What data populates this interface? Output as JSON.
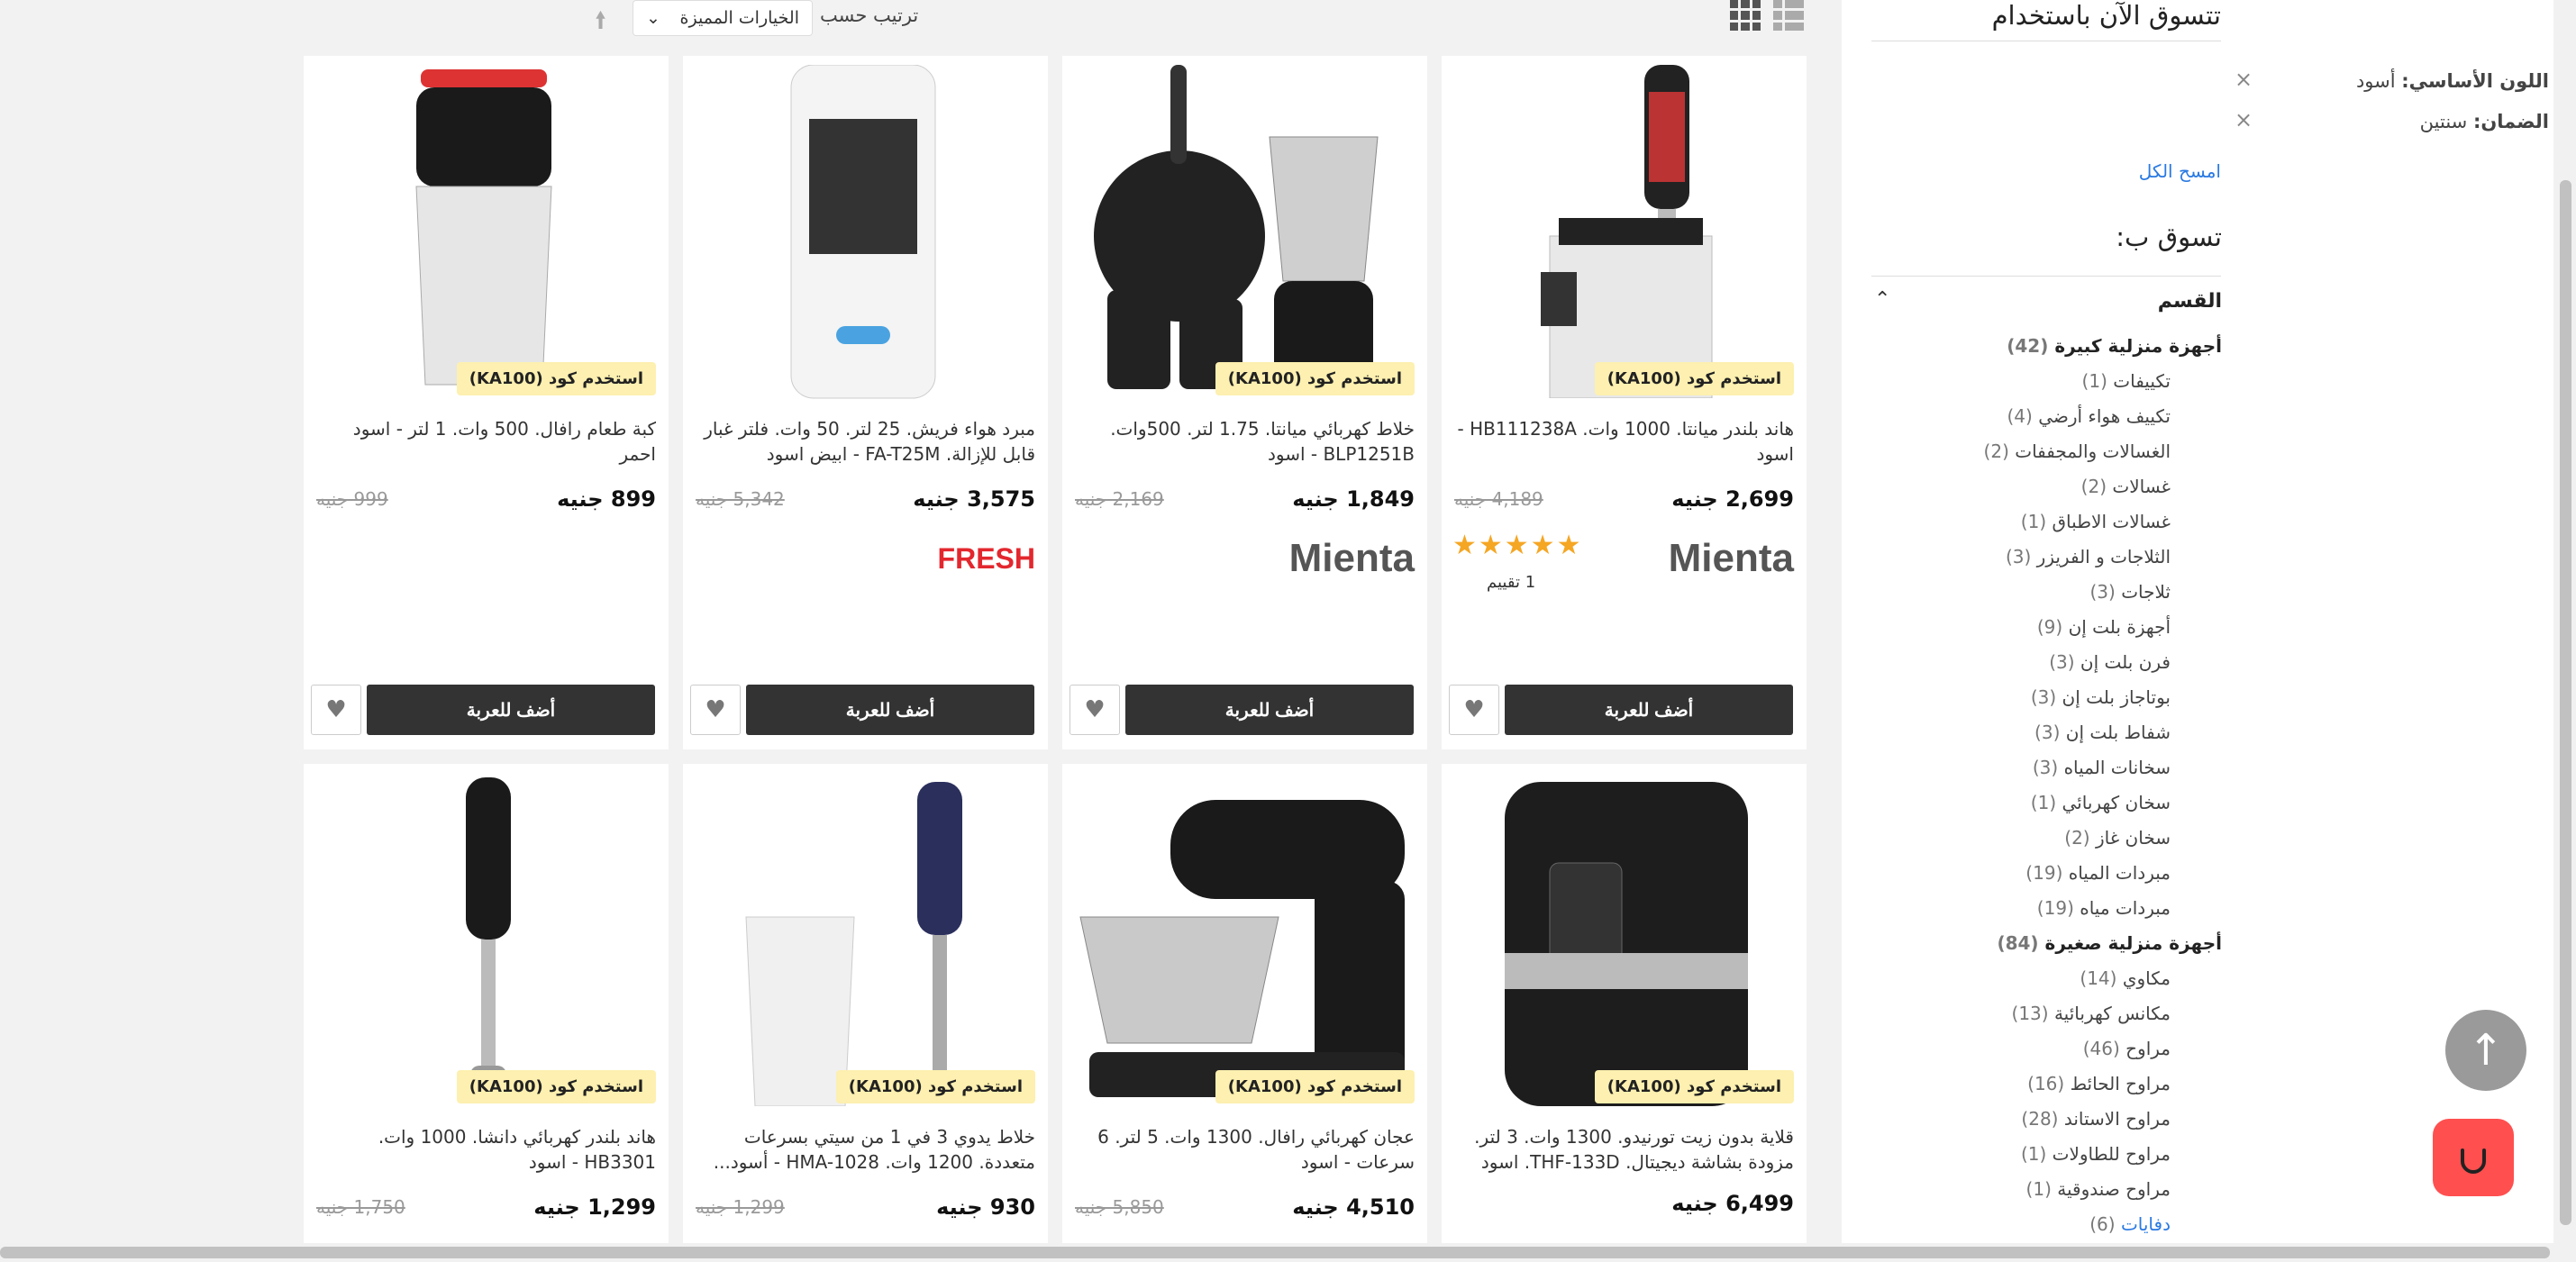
{
  "toolbar": {
    "sort_label": "ترتيب حسب",
    "sort_value": "الخيارات المميزة",
    "sort_dir_icon": "arrow-up-icon",
    "view_grid_icon": "grid-view-icon",
    "view_list_icon": "list-view-icon"
  },
  "products": [
    {
      "promo": "استخدم كود (KA100)",
      "title": "هاند بلندر ميانتا. 1000 وات. HB111238A - اسود",
      "price": "2,699 جنيه",
      "old_price": "4,189 جنيه",
      "brand": "Mienta",
      "stars": "★★★★★",
      "reviews": "1 تقييم",
      "add": "أضف للعربة"
    },
    {
      "promo": "استخدم كود (KA100)",
      "title": "خلاط كهربائي ميانتا. 1.75 لتر. 500وات. BLP1251B - اسود",
      "price": "1,849 جنيه",
      "old_price": "2,169 جنيه",
      "brand": "Mienta",
      "add": "أضف للعربة"
    },
    {
      "title": "مبرد هواء فريش. 25 لتر. 50 وات. فلتر غبار قابل للإزالة. FA-T25M - ابيض اسود",
      "price": "3,575 جنيه",
      "old_price": "5,342 جنيه",
      "brand": "FRESH",
      "add": "أضف للعربة"
    },
    {
      "promo": "استخدم كود (KA100)",
      "title": "كبة طعام رافال. 500 وات. 1 لتر - اسود احمر",
      "price": "899 جنيه",
      "old_price": "999 جنيه",
      "add": "أضف للعربة"
    },
    {
      "promo": "استخدم كود (KA100)",
      "title": "قلاية بدون زيت تورنيدو. 1300 وات. 3 لتر. مزودة بشاشة ديجيتال. THF-133D. اسود",
      "price": "6,499 جنيه"
    },
    {
      "promo": "استخدم كود (KA100)",
      "title": "عجان كهربائي رافال. 1300 وات. 5 لتر. 6 سرعات - اسود",
      "price": "4,510 جنيه",
      "old_price": "5,850 جنيه"
    },
    {
      "promo": "استخدم كود (KA100)",
      "title": "خلاط يدوي 3 في 1 من سيتي بسرعات متعددة. 1200 وات. HMA-1028 - أسود...",
      "price": "930 جنيه",
      "old_price": "1,299 جنيه"
    },
    {
      "promo": "استخدم كود (KA100)",
      "title": "هاند بلندر كهربائي دانشا. 1000 وات. HB3301 - اسود",
      "price": "1,299 جنيه",
      "old_price": "1,750 جنيه"
    }
  ],
  "sidebar": {
    "title": "تتسوق الآن باستخدام",
    "filters": [
      {
        "name": "اللون الأساسي:",
        "value": "أسود"
      },
      {
        "name": "الضمان:",
        "value": "سنتين"
      }
    ],
    "clear_all": "امسح الكل",
    "shop_by": "تسوق ب:",
    "category_header": "القسم",
    "categories": [
      {
        "label": "أجهزة منزلية كبيرة",
        "count": "(42)",
        "main": true
      },
      {
        "label": "تكييفات",
        "count": "(1)"
      },
      {
        "label": "تكييف هواء أرضي",
        "count": "(4)"
      },
      {
        "label": "الغسالات والمجففات",
        "count": "(2)"
      },
      {
        "label": "غسالات",
        "count": "(2)"
      },
      {
        "label": "غسالات الاطباق",
        "count": "(1)"
      },
      {
        "label": "الثلاجات و الفريزر",
        "count": "(3)"
      },
      {
        "label": "ثلاجات",
        "count": "(3)"
      },
      {
        "label": "أجهزة بلت إن",
        "count": "(9)"
      },
      {
        "label": "فرن بلت إن",
        "count": "(3)"
      },
      {
        "label": "بوتاجاز بلت إن",
        "count": "(3)"
      },
      {
        "label": "شفاط بلت إن",
        "count": "(3)"
      },
      {
        "label": "سخانات المياه",
        "count": "(3)"
      },
      {
        "label": "سخان كهربائي",
        "count": "(1)"
      },
      {
        "label": "سخان غاز",
        "count": "(2)"
      },
      {
        "label": "مبردات المياه",
        "count": "(19)"
      },
      {
        "label": "مبردات مياه",
        "count": "(19)"
      },
      {
        "label": "أجهزة منزلية صغيرة",
        "count": "(84)",
        "main": true
      },
      {
        "label": "مكاوي",
        "count": "(14)"
      },
      {
        "label": "مكانس كهربائية",
        "count": "(13)"
      },
      {
        "label": "مراوح",
        "count": "(46)"
      },
      {
        "label": "مراوح الحائط",
        "count": "(16)"
      },
      {
        "label": "مراوح الاستاند",
        "count": "(28)"
      },
      {
        "label": "مراوح للطاولات",
        "count": "(1)"
      },
      {
        "label": "مراوح صندوقية",
        "count": "(1)"
      },
      {
        "label": "دفايات",
        "count": "(6)",
        "link": true
      }
    ]
  },
  "floating": {
    "scroll_top_icon": "arrow-up-icon",
    "chat_icon": "chat-smile-icon"
  }
}
